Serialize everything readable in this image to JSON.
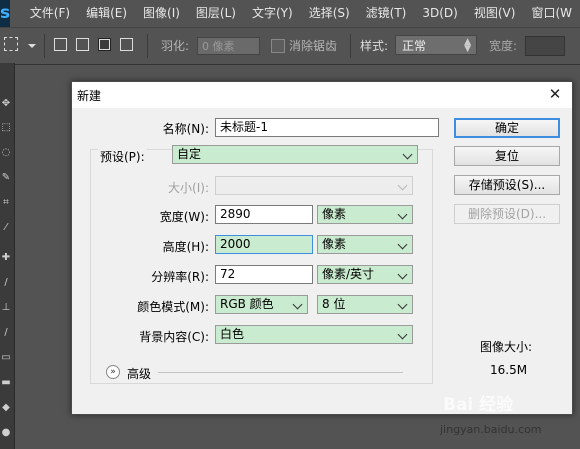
{
  "app": {
    "logo_letter": "s",
    "menu": [
      "文件(F)",
      "编辑(E)",
      "图像(I)",
      "图层(L)",
      "文字(Y)",
      "选择(S)",
      "滤镜(T)",
      "3D(D)",
      "视图(V)",
      "窗口(W"
    ]
  },
  "options_bar": {
    "feather_label": "羽化:",
    "feather_value": "0 像素",
    "antialias_label": "消除锯齿",
    "style_label": "样式:",
    "style_value": "正常",
    "width_label": "宽度:"
  },
  "dialog": {
    "title": "新建",
    "name_label": "名称(N):",
    "name_value": "未标题-1",
    "preset_label": "预设(P):",
    "preset_value": "自定",
    "size_label": "大小(I):",
    "size_value": "",
    "width_label": "宽度(W):",
    "width_value": "2890",
    "width_unit": "像素",
    "height_label": "高度(H):",
    "height_value": "2000",
    "height_unit": "像素",
    "resolution_label": "分辨率(R):",
    "resolution_value": "72",
    "resolution_unit": "像素/英寸",
    "color_mode_label": "颜色模式(M):",
    "color_mode_value": "RGB 颜色",
    "bit_depth_value": "8 位",
    "background_label": "背景内容(C):",
    "background_value": "白色",
    "advanced_label": "高级",
    "ok_label": "确定",
    "reset_label": "复位",
    "save_preset_label": "存储预设(S)...",
    "delete_preset_label": "删除预设(D)...",
    "image_size_label": "图像大小:",
    "image_size_value": "16.5M"
  },
  "watermark": {
    "brand": "Bai 经验",
    "url": "jingyan.baidu.com"
  }
}
